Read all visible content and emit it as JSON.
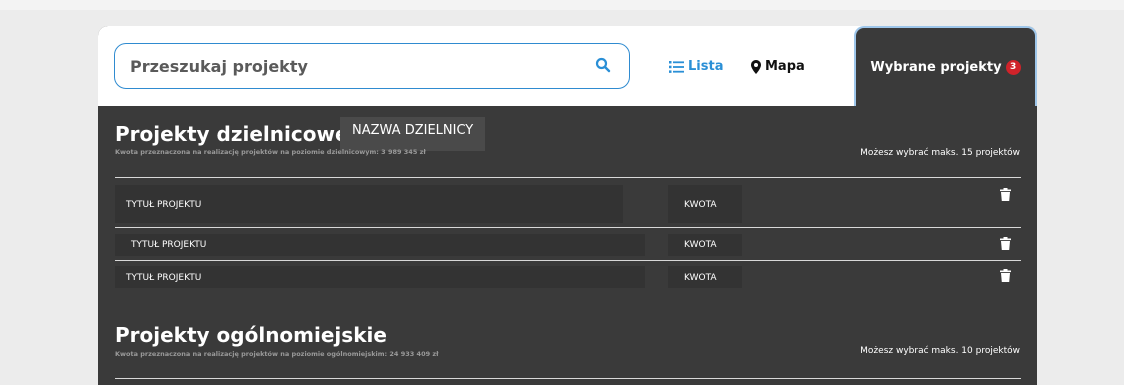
{
  "search": {
    "placeholder": "Przeszukaj projekty",
    "value": ""
  },
  "views": {
    "list_label": "Lista",
    "map_label": "Mapa"
  },
  "selected_tab": {
    "label": "Wybrane projekty",
    "count": "3"
  },
  "district_section": {
    "title": "Projekty dzielnicowe",
    "district_name": "NAZWA DZIELNICY",
    "subtitle": "Kwota przeznaczona na realizację projektów na poziomie dzielnicowym: 3 989 345 zł",
    "max_info": "Możesz wybrać maks. 15 projektów",
    "rows": [
      {
        "title": "TYTUŁ PROJEKTU",
        "amount": "KWOTA"
      },
      {
        "title": "TYTUŁ PROJEKTU",
        "amount": "KWOTA"
      },
      {
        "title": "TYTUŁ PROJEKTU",
        "amount": "KWOTA"
      }
    ]
  },
  "city_section": {
    "title": "Projekty ogólnomiejskie",
    "subtitle": "Kwota przeznaczona na realizację projektów na poziomie ogólnomiejskim: 24 933 409 zł",
    "max_info": "Możesz wybrać maks. 10 projektów"
  },
  "icons": {
    "search": "search-icon",
    "list": "list-icon",
    "map": "map-marker-icon",
    "delete": "trash-icon"
  },
  "colors": {
    "panel": "#3a3a3a",
    "accent": "#2a8fd6",
    "badge": "#d0232a"
  }
}
